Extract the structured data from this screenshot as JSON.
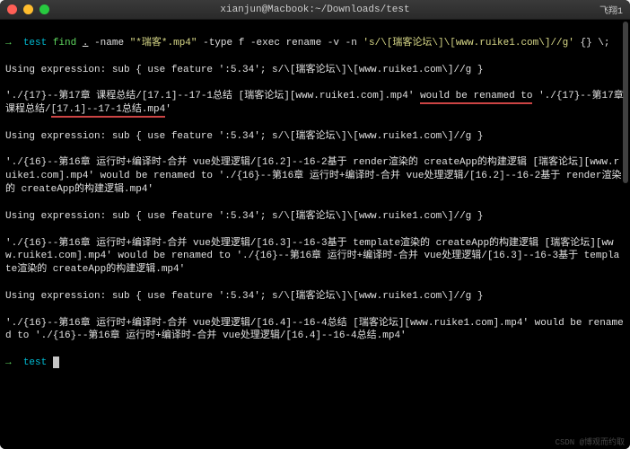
{
  "titlebar": {
    "title": "xianjun@Macbook:~/Downloads/test",
    "status_right": "飞翔1"
  },
  "traffic": {
    "close": "close",
    "minimize": "minimize",
    "maximize": "maximize"
  },
  "prompt": {
    "arrow": "→",
    "cwd": "test"
  },
  "cmd": {
    "find": "find",
    "dot": ".",
    "name_flag": "-name",
    "name_pattern": "\"*瑞客*.mp4\"",
    "type_flag": "-type",
    "type_val": "f",
    "exec_flag": "-exec",
    "rename": "rename",
    "v_flag": "-v",
    "n_flag": "-n",
    "sed": "'s/\\[瑞客论坛\\]\\[www.ruike1.com\\]//g'",
    "braces": "{}",
    "semi": "\\;"
  },
  "out": {
    "expr": "Using expression: sub { use feature ':5.34'; s/\\[瑞客论坛\\]\\[www.ruike1.com\\]//g }",
    "l2a": "'./{17}--第17章 课程总结/[17.1]--17-1总结 [瑞客论坛][www.ruike1.com].mp4' ",
    "l2b": "would be renamed to",
    "l2c": " './{17}--第17章 课程总结/",
    "l2d": "[17.1]--17-1总结.mp4",
    "l2e": "'",
    "l4": "'./{16}--第16章 运行时+编译时-合并 vue处理逻辑/[16.2]--16-2基于 render渲染的 createApp的构建逻辑 [瑞客论坛][www.ruike1.com].mp4' would be renamed to './{16}--第16章 运行时+编译时-合并 vue处理逻辑/[16.2]--16-2基于 render渲染的 createApp的构建逻辑.mp4'",
    "l6": "'./{16}--第16章 运行时+编译时-合并 vue处理逻辑/[16.3]--16-3基于 template渲染的 createApp的构建逻辑 [瑞客论坛][www.ruike1.com].mp4' would be renamed to './{16}--第16章 运行时+编译时-合并 vue处理逻辑/[16.3]--16-3基于 template渲染的 createApp的构建逻辑.mp4'",
    "l8": "'./{16}--第16章 运行时+编译时-合并 vue处理逻辑/[16.4]--16-4总结 [瑞客论坛][www.ruike1.com].mp4' would be renamed to './{16}--第16章 运行时+编译时-合并 vue处理逻辑/[16.4]--16-4总结.mp4'"
  },
  "watermark": "CSDN @博观而约取"
}
